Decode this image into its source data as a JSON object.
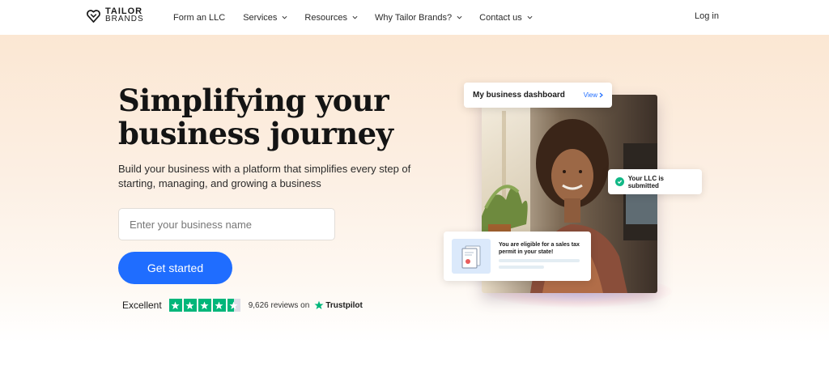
{
  "header": {
    "logo_top": "TAILOR",
    "logo_bottom": "BRANDS",
    "nav": [
      {
        "label": "Form an LLC",
        "has_dropdown": false
      },
      {
        "label": "Services",
        "has_dropdown": true
      },
      {
        "label": "Resources",
        "has_dropdown": true
      },
      {
        "label": "Why Tailor Brands?",
        "has_dropdown": true
      },
      {
        "label": "Contact us",
        "has_dropdown": true
      }
    ],
    "login_label": "Log in"
  },
  "hero": {
    "headline_line1": "Simplifying your",
    "headline_line2": "business journey",
    "subheading": "Build your business with a platform that simplifies every step of starting, managing, and growing a business",
    "input_placeholder": "Enter your business name",
    "input_value": "",
    "cta_label": "Get started",
    "rating": {
      "label": "Excellent",
      "stars": 4.5,
      "reviews_text": "9,626 reviews on",
      "provider": "Trustpilot"
    }
  },
  "visual": {
    "dashboard_title": "My business dashboard",
    "dashboard_link": "View",
    "llc_status": "Your LLC is submitted",
    "permit_text": "You are eligible for a sales tax permit in your state!"
  },
  "colors": {
    "accent": "#1f6dff",
    "trustpilot_green": "#00b67a",
    "success": "#12b886",
    "hero_bg": "#fbe7d3"
  },
  "icons": [
    "tailor-brands-logo-icon",
    "chevron-down-icon",
    "trustpilot-star-icon",
    "check-icon",
    "chevron-right-icon",
    "document-icon"
  ]
}
